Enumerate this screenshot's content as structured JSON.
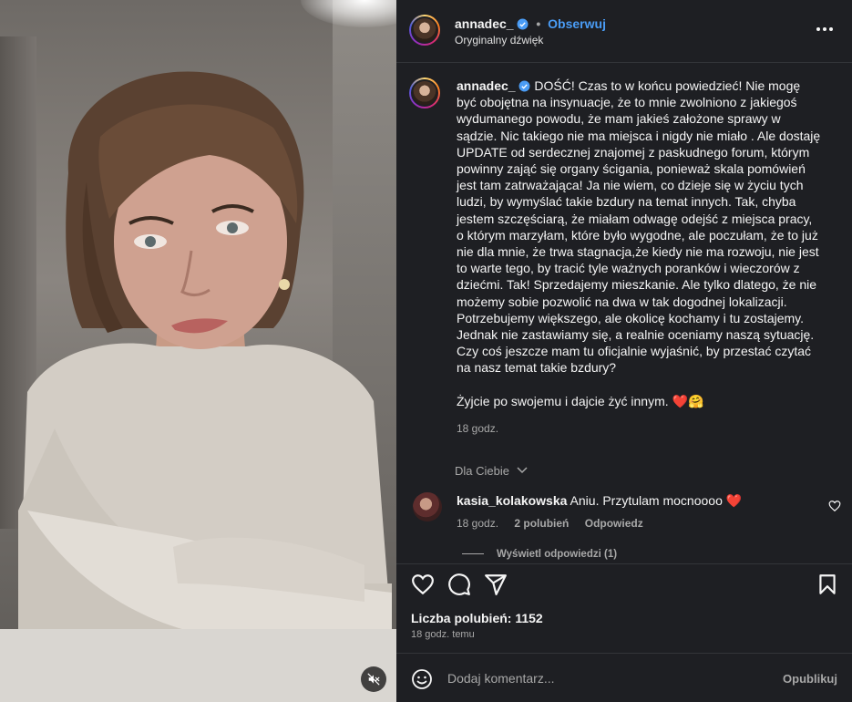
{
  "post": {
    "username": "annadec_",
    "separator": "•",
    "follow_label": "Obserwuj",
    "audio": "Oryginalny dźwięk",
    "caption": "DOŚĆ! Czas to w końcu powiedzieć! Nie mogę być obojętna na insynuacje, że to mnie zwolniono z jakiegoś wydumanego powodu, że mam jakieś założone sprawy w sądzie. Nic takiego nie ma miejsca i nigdy nie miało . Ale dostaję UPDATE od serdecznej znajomej z paskudnego forum, którym powinny zająć się organy ścigania, ponieważ skala pomówień jest tam zatrważająca! Ja nie wiem, co dzieje się w życiu tych ludzi, by wymyślać takie bzdury na temat innych. Tak, chyba jestem szczęściarą, że miałam odwagę odejść z miejsca pracy, o którym marzyłam, które było wygodne, ale poczułam, że to już nie dla mnie, że trwa stagnacja,że kiedy nie ma rozwoju, nie jest to warte tego, by tracić tyle ważnych poranków i wieczorów z dziećmi. Tak! Sprzedajemy mieszkanie. Ale tylko dlatego, że nie możemy sobie pozwolić na dwa w tak dogodnej lokalizacji. Potrzebujemy większego, ale okolicę kochamy i tu zostajemy. Jednak nie zastawiamy się, a realnie oceniamy naszą sytuację. Czy coś jeszcze mam tu oficjalnie wyjaśnić, by przestać czytać na nasz temat takie bzdury?",
    "caption_tail": "Żyjcie po swojemu i dajcie żyć innym. ❤️🤗",
    "caption_time": "18 godz.",
    "for_you": "Dla Ciebie",
    "comment": {
      "username": "kasia_kolakowska",
      "text": "Aniu. Przytulam mocnoooo ❤️",
      "time": "18 godz.",
      "likes": "2 polubień",
      "reply": "Odpowiedz"
    },
    "view_replies": "Wyświetl odpowiedzi (1)",
    "likes_label": "Liczba polubień: 1152",
    "posted_time": "18 godz. temu",
    "comment_placeholder": "Dodaj komentarz...",
    "publish_label": "Opublikuj"
  },
  "icons": {
    "verified": "verified-badge-icon",
    "more": "more-options-icon",
    "like": "heart-icon",
    "comment": "comment-icon",
    "share": "share-icon",
    "save": "bookmark-icon",
    "emoji": "emoji-icon",
    "mute": "muted-speaker-icon"
  },
  "colors": {
    "accent": "#4a9cf5",
    "panel_bg": "#1e1f23",
    "muted_text": "#a8a8a8",
    "like_red": "#e0245e"
  }
}
